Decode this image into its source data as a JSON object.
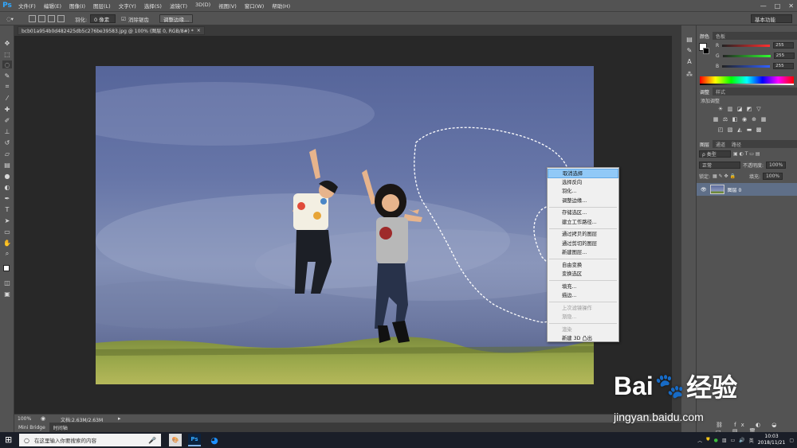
{
  "app": {
    "logo": "Ps",
    "menus": [
      "文件(F)",
      "编辑(E)",
      "图像(I)",
      "图层(L)",
      "文字(Y)",
      "选择(S)",
      "滤镜(T)",
      "3D(D)",
      "视图(V)",
      "窗口(W)",
      "帮助(H)"
    ],
    "window_controls": [
      "—",
      "□",
      "✕"
    ]
  },
  "options_bar": {
    "feather_label": "羽化:",
    "feather_value": "0 像素",
    "antialias_label": "消除锯齿",
    "refine_edge_button": "调整边缘...",
    "workspace": "基本功能"
  },
  "document": {
    "tab_title": "bcb01a954b0d482425db5c276be39583.jpg @ 100% (图层 0, RGB/8#) *",
    "tab_close": "×"
  },
  "context_menu": {
    "groups": [
      [
        {
          "label": "取消选择",
          "active": true
        },
        {
          "label": "选择反向"
        },
        {
          "label": "羽化..."
        },
        {
          "label": "调整边缘..."
        }
      ],
      [
        {
          "label": "存储选区..."
        },
        {
          "label": "建立工作路径..."
        }
      ],
      [
        {
          "label": "通过拷贝的图层"
        },
        {
          "label": "通过剪切的图层"
        },
        {
          "label": "新建图层..."
        }
      ],
      [
        {
          "label": "自由变换"
        },
        {
          "label": "变换选区"
        }
      ],
      [
        {
          "label": "填充..."
        },
        {
          "label": "描边..."
        }
      ],
      [
        {
          "label": "上次滤镜操作",
          "disabled": true
        },
        {
          "label": "渐隐...",
          "disabled": true
        }
      ],
      [
        {
          "label": "渲染",
          "disabled": true
        },
        {
          "label": "新建 3D 凸出"
        }
      ]
    ]
  },
  "status_bar": {
    "zoom": "100%",
    "doc_info": "文档:2.63M/2.63M"
  },
  "bottom_tabs": [
    "Mini Bridge",
    "时间轴"
  ],
  "panels": {
    "color": {
      "tabs": [
        "颜色",
        "色板"
      ],
      "channels": [
        {
          "label": "R",
          "value": "255",
          "color": "#ff3030"
        },
        {
          "label": "G",
          "value": "255",
          "color": "#30ff30"
        },
        {
          "label": "B",
          "value": "255",
          "color": "#3060ff"
        }
      ]
    },
    "adjustments": {
      "tabs": [
        "调整",
        "样式"
      ],
      "title": "添加调整"
    },
    "layers": {
      "tabs": [
        "图层",
        "通道",
        "路径"
      ],
      "kind_filter": "ρ 类型",
      "blend_mode": "正常",
      "opacity_label": "不透明度:",
      "opacity_value": "100%",
      "lock_label": "锁定:",
      "fill_label": "填充:",
      "fill_value": "100%",
      "layer_name": "图层 0"
    }
  },
  "taskbar": {
    "search_placeholder": "在这里输入你要搜索的内容",
    "ime": "英",
    "time": "10:03",
    "date": "2018/11/21"
  },
  "watermark": {
    "brand": "Bai",
    "brand_cn": "经验",
    "url": "jingyan.baidu.com"
  }
}
